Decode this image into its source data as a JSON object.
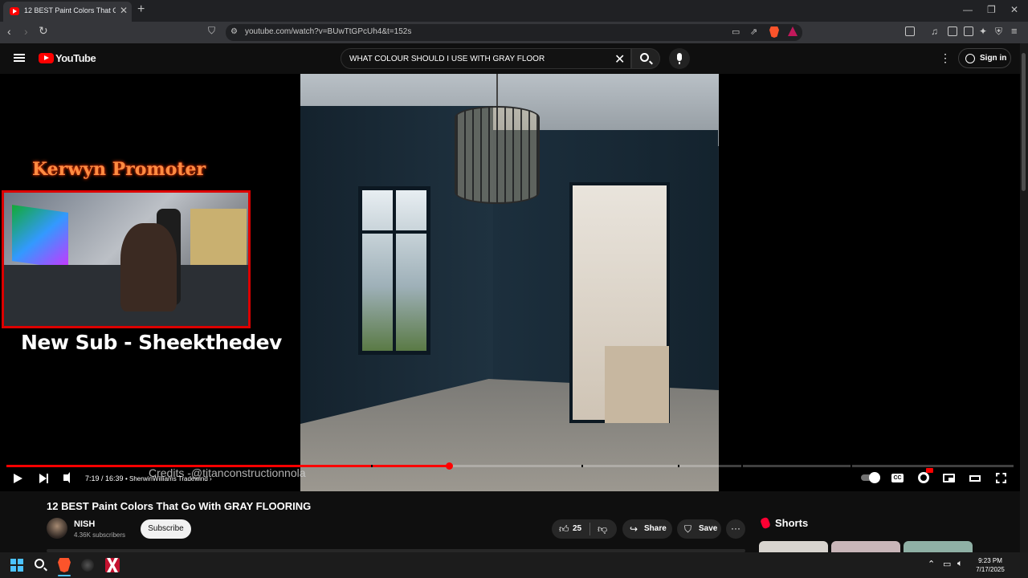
{
  "browser": {
    "tab_title": "12 BEST Paint Colors That Go With GRAY FLOORING",
    "url": "youtube.com/watch?v=BUwTtGPcUh4&t=152s",
    "window_controls": {
      "minimize": "—",
      "restore": "❐",
      "close": "✕"
    }
  },
  "youtube": {
    "logo_text": "YouTube",
    "search_value": "WHAT COLOUR SHOULD I USE WITH GRAY FLOOR",
    "signin_label": "Sign in"
  },
  "player": {
    "overlay_title": "Kerwyn Promoter",
    "overlay_subscriber": "New Sub - Sheekthedev",
    "credits": "Credits -@titanconstructionnola",
    "current_time": "7:19",
    "duration": "16:39",
    "time_display": "7:19 / 16:39",
    "chapter": "• SherwinWilliams Tradewind  ›",
    "progress_fraction": 0.439,
    "chapter_marks": [
      0.362,
      0.571,
      0.667,
      0.73,
      0.838
    ],
    "accent_color": "#ff0000"
  },
  "video_info": {
    "title": "12 BEST Paint Colors That Go With GRAY FLOORING",
    "channel_name": "NISH",
    "subscribers": "4.36K subscribers",
    "subscribe_label": "Subscribe",
    "likes": "25",
    "share_label": "Share",
    "save_label": "Save",
    "more_label": "···"
  },
  "sidebar": {
    "shorts_label": "Shorts"
  },
  "taskbar": {
    "time": "9:23 PM",
    "date": "7/17/2025"
  }
}
